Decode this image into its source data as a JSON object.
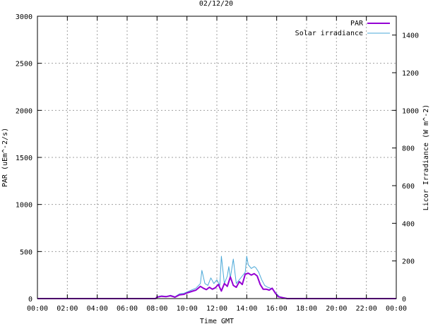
{
  "chart_data": {
    "type": "line",
    "title": "02/12/20",
    "xlabel": "Time GMT",
    "ylabel": "PAR (uEm^-2/s)",
    "y2label": "Licor Irradiance (W m^-2)",
    "xlim": [
      0,
      24
    ],
    "ylim": [
      0,
      3000
    ],
    "y2lim": [
      0,
      1500
    ],
    "x_ticks": [
      0,
      2,
      4,
      6,
      8,
      10,
      12,
      14,
      16,
      18,
      20,
      22,
      24
    ],
    "x_tick_labels": [
      "00:00",
      "02:00",
      "04:00",
      "06:00",
      "08:00",
      "10:00",
      "12:00",
      "14:00",
      "16:00",
      "18:00",
      "20:00",
      "22:00",
      "00:00"
    ],
    "y_ticks": [
      0,
      500,
      1000,
      1500,
      2000,
      2500,
      3000
    ],
    "y2_ticks": [
      0,
      200,
      400,
      600,
      800,
      1000,
      1200,
      1400
    ],
    "grid": true,
    "legend_position": "top-right",
    "series": [
      {
        "name": "PAR",
        "axis": "left",
        "color": "#9400d3",
        "x": [
          0,
          7.9,
          8.0,
          8.3,
          8.6,
          8.9,
          9.2,
          9.5,
          9.8,
          10.0,
          10.3,
          10.6,
          10.9,
          11.1,
          11.3,
          11.5,
          11.7,
          11.9,
          12.1,
          12.3,
          12.5,
          12.7,
          12.9,
          13.1,
          13.3,
          13.5,
          13.7,
          13.9,
          14.1,
          14.3,
          14.5,
          14.7,
          14.9,
          15.1,
          15.3,
          15.5,
          15.7,
          15.9,
          16.1,
          16.4,
          16.7,
          24
        ],
        "y": [
          0,
          0,
          15,
          25,
          20,
          30,
          15,
          40,
          45,
          60,
          75,
          90,
          130,
          110,
          95,
          120,
          100,
          115,
          150,
          80,
          160,
          130,
          230,
          140,
          120,
          180,
          150,
          260,
          270,
          250,
          265,
          240,
          150,
          100,
          100,
          90,
          110,
          60,
          20,
          10,
          0,
          0
        ]
      },
      {
        "name": "Solar irradiance",
        "axis": "right",
        "color": "#4aa8d8",
        "x": [
          0,
          7.9,
          8.0,
          8.3,
          8.6,
          8.9,
          9.2,
          9.5,
          9.8,
          10.0,
          10.3,
          10.6,
          10.9,
          11.0,
          11.2,
          11.4,
          11.6,
          11.8,
          12.0,
          12.2,
          12.3,
          12.5,
          12.7,
          12.8,
          12.9,
          13.1,
          13.3,
          13.5,
          13.7,
          13.9,
          14.0,
          14.1,
          14.3,
          14.5,
          14.6,
          14.8,
          15.0,
          15.2,
          15.4,
          15.6,
          15.8,
          16.0,
          16.2,
          16.5,
          16.8,
          24
        ],
        "y": [
          0,
          0,
          10,
          15,
          12,
          18,
          10,
          25,
          28,
          35,
          45,
          55,
          80,
          150,
          80,
          70,
          110,
          80,
          100,
          70,
          225,
          80,
          120,
          170,
          110,
          210,
          80,
          100,
          120,
          140,
          225,
          180,
          160,
          170,
          165,
          140,
          100,
          70,
          60,
          55,
          45,
          25,
          10,
          5,
          0,
          0
        ]
      }
    ]
  }
}
